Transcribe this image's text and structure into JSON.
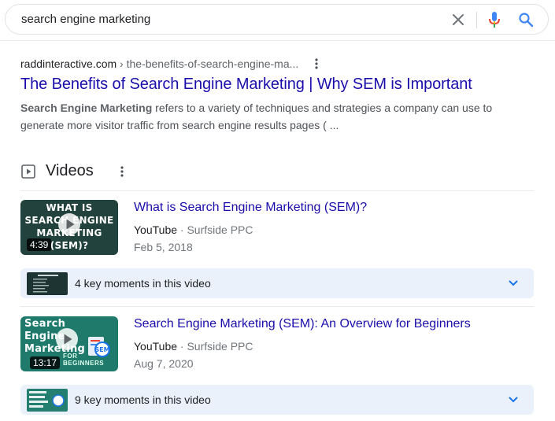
{
  "search": {
    "query": "search engine marketing"
  },
  "result": {
    "domain": "raddinteractive.com",
    "path": " › the-benefits-of-search-engine-ma...",
    "title": "The Benefits of Search Engine Marketing | Why SEM is Important",
    "snippet_bold": "Search Engine Marketing",
    "snippet_rest": " refers to a variety of techniques and strategies a company can use to generate more visitor traffic from search engine results pages ( ..."
  },
  "videos": {
    "header": "Videos",
    "items": [
      {
        "title": "What is Search Engine Marketing (SEM)?",
        "platform": "YouTube",
        "separator": " · ",
        "channel": "Surfside PPC",
        "date": "Feb 5, 2018",
        "duration": "4:39",
        "thumb_text": "WHAT IS SEARCH ENGINE MARKETING (SEM)?",
        "thumb_lines": [
          "WHAT IS",
          "SEARCH ENGINE",
          "MARKETING",
          "(SEM)?"
        ],
        "key_moments": "4 key moments in this video"
      },
      {
        "title": "Search Engine Marketing (SEM): An Overview for Beginners",
        "platform": "YouTube",
        "separator": " · ",
        "channel": "Surfside PPC",
        "date": "Aug 7, 2020",
        "duration": "13:17",
        "thumb_lines": [
          "Search",
          "Engine",
          "Marketing"
        ],
        "thumb_badge": "SEM",
        "thumb_footer": "FOR BEGINNERS",
        "key_moments": "9 key moments in this video"
      }
    ]
  },
  "colors": {
    "link": "#1a0dab",
    "key_moments_bg": "#eaf1fb",
    "google_blue": "#4285f4",
    "google_red": "#ea4335"
  },
  "icons": [
    "clear-icon",
    "microphone-icon",
    "search-icon",
    "more-vert-icon",
    "video-play-icon",
    "chevron-down-icon"
  ]
}
